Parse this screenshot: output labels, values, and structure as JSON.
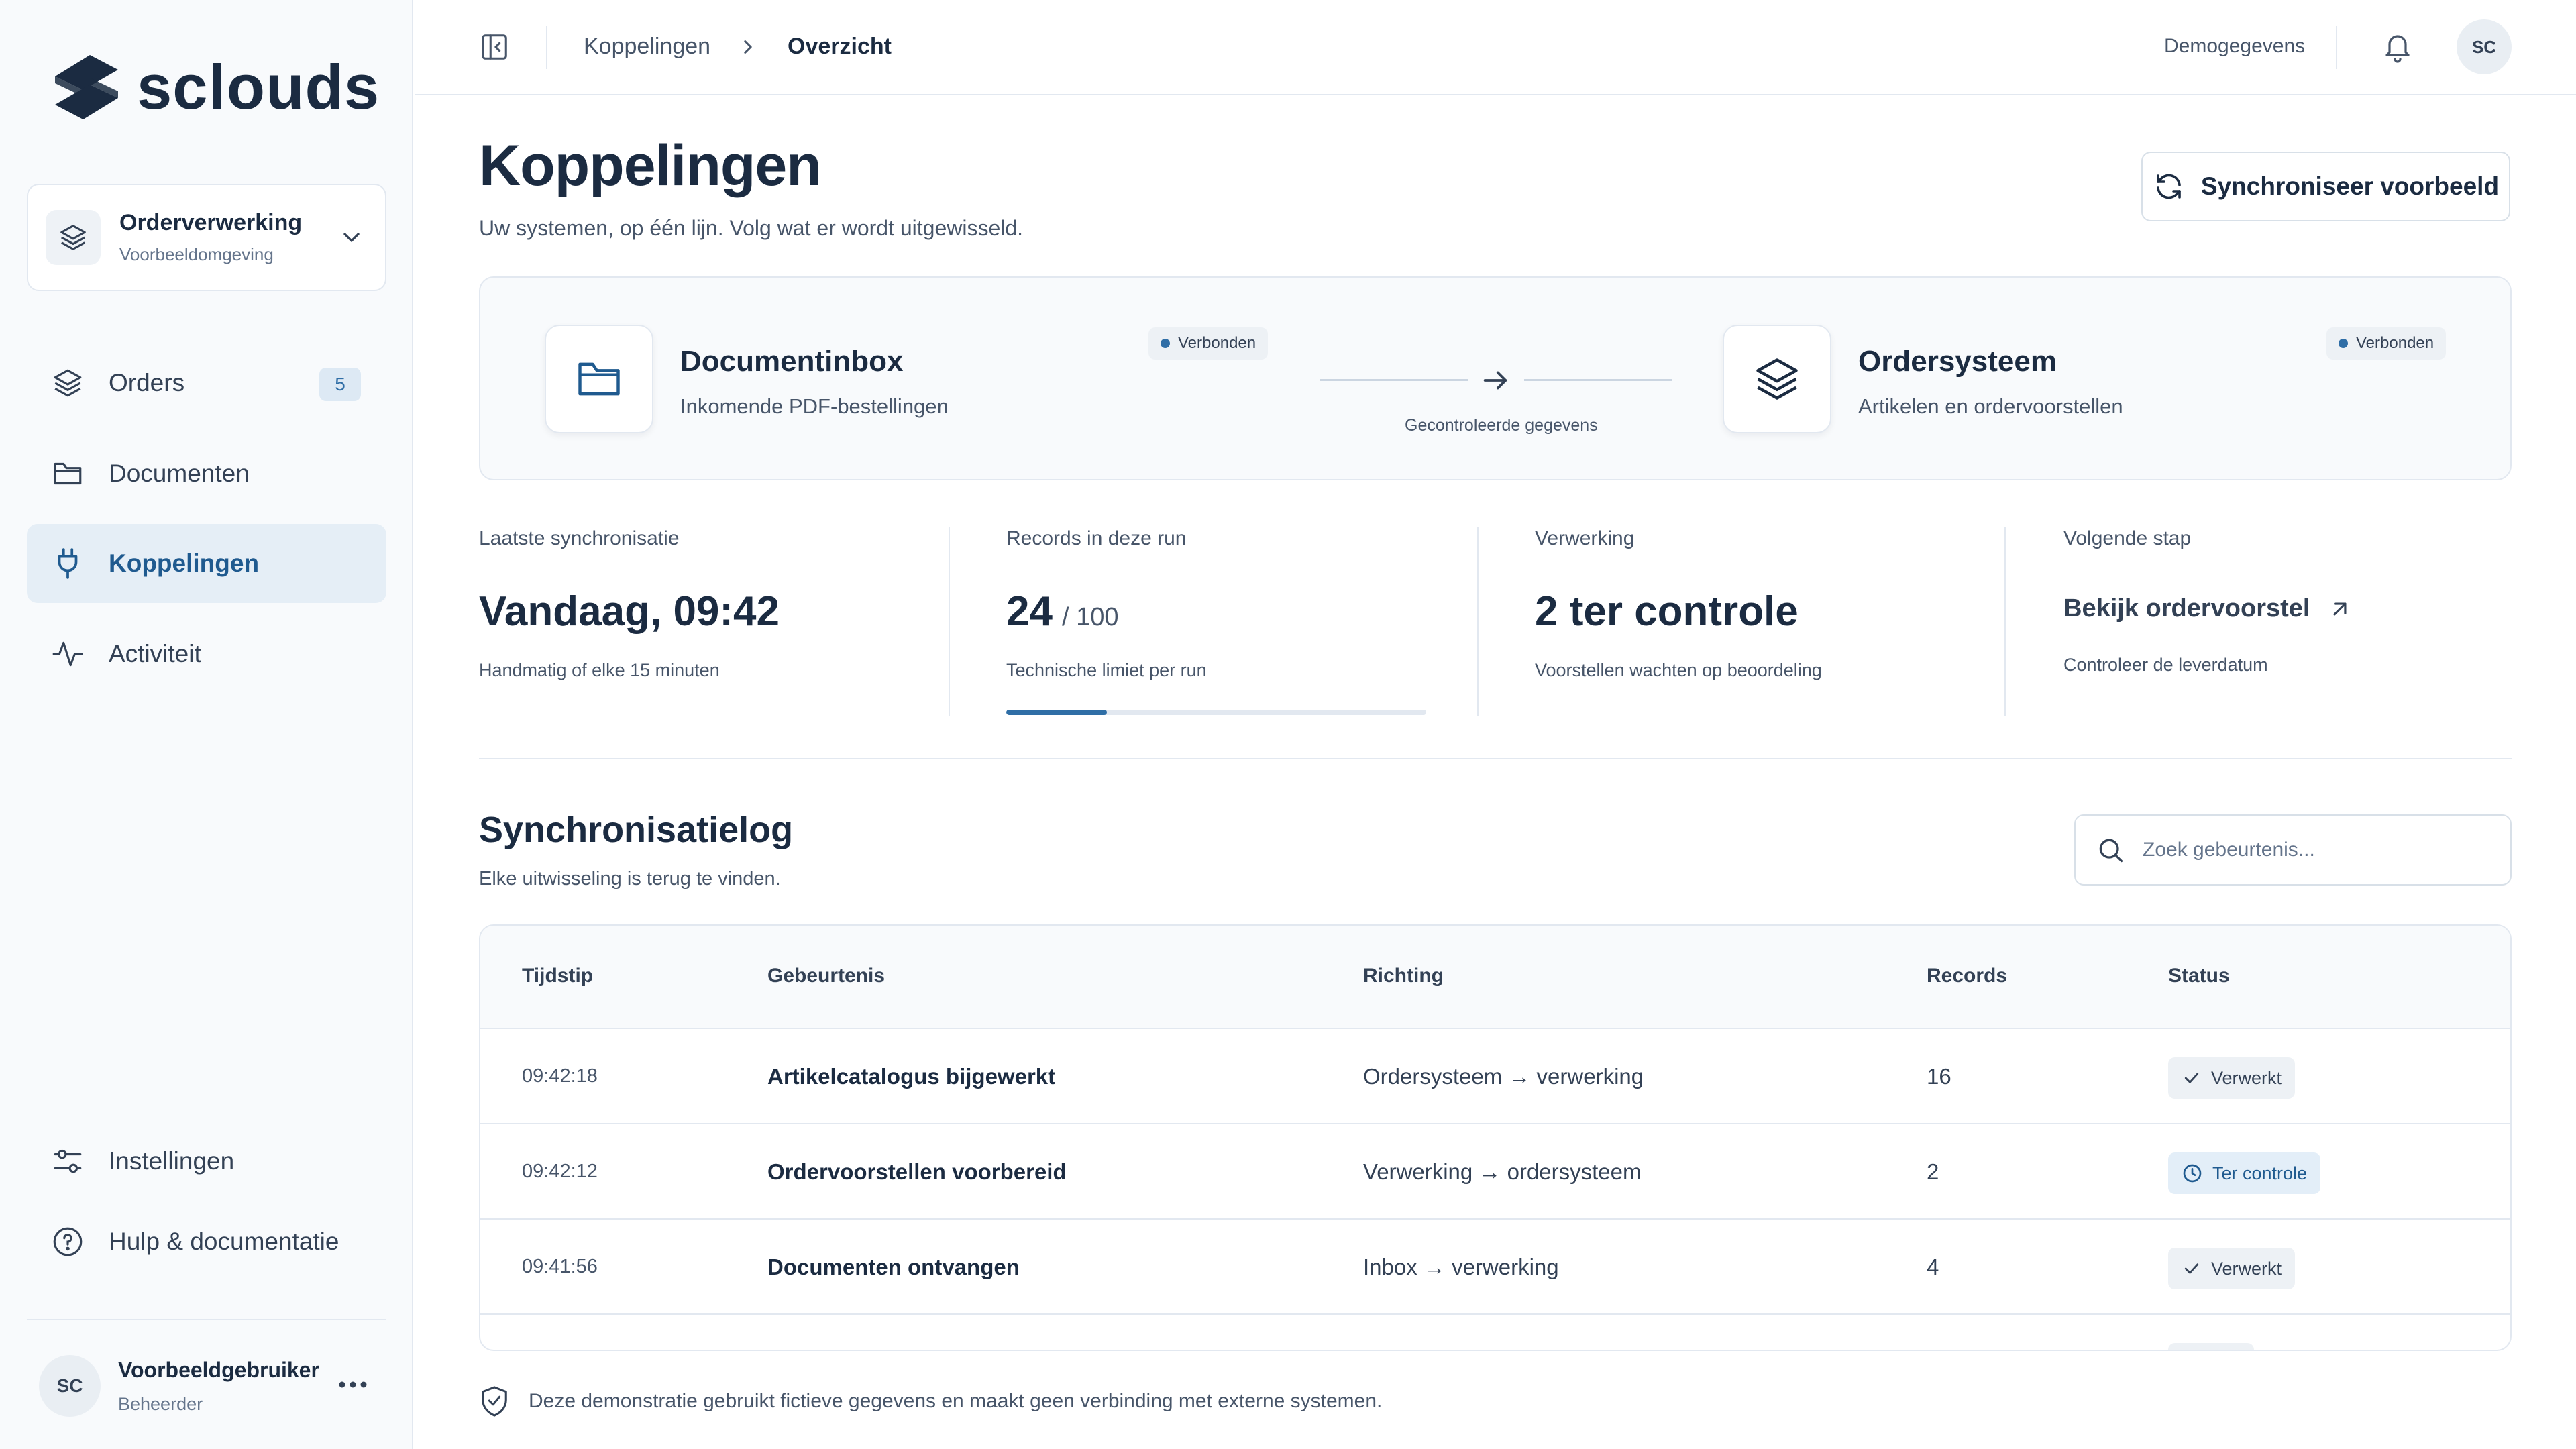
{
  "app": {
    "logo_text": "sclouds"
  },
  "environment": {
    "title": "Orderverwerking",
    "subtitle": "Voorbeeldomgeving"
  },
  "sidebar": {
    "items": [
      {
        "label": "Orders",
        "icon": "layers-icon",
        "badge": "5"
      },
      {
        "label": "Documenten",
        "icon": "folder-icon"
      },
      {
        "label": "Koppelingen",
        "icon": "plug-icon",
        "active": true
      },
      {
        "label": "Activiteit",
        "icon": "activity-icon"
      }
    ],
    "bottom_items": [
      {
        "label": "Instellingen",
        "icon": "sliders-icon"
      },
      {
        "label": "Hulp & documentatie",
        "icon": "help-icon"
      }
    ]
  },
  "user": {
    "initials": "SC",
    "name": "Voorbeeldgebruiker",
    "role": "Beheerder"
  },
  "topbar": {
    "breadcrumb": [
      "Koppelingen",
      "Overzicht"
    ],
    "demo_link": "Demogegevens",
    "avatar": "SC"
  },
  "page": {
    "title": "Koppelingen",
    "subtitle": "Uw systemen, op één lijn. Volg wat er wordt uitgewisseld.",
    "sync_button": "Synchroniseer voorbeeld"
  },
  "flow": {
    "source": {
      "title": "Documentinbox",
      "subtitle": "Inkomende PDF-bestellingen",
      "status": "Verbonden"
    },
    "connector_label": "Gecontroleerde gegevens",
    "target": {
      "title": "Ordersysteem",
      "subtitle": "Artikelen en ordervoorstellen",
      "status": "Verbonden"
    }
  },
  "stats": {
    "last_sync": {
      "label": "Laatste synchronisatie",
      "value": "Vandaag, 09:42",
      "note": "Handmatig of elke 15 minuten"
    },
    "records": {
      "label": "Records in deze run",
      "value": "24",
      "unit": "/ 100",
      "note": "Technische limiet per run",
      "progress": 0.24
    },
    "processing": {
      "label": "Verwerking",
      "value": "2 ter controle",
      "note": "Voorstellen wachten op beoordeling"
    },
    "next_step": {
      "label": "Volgende stap",
      "link": "Bekijk ordervoorstel",
      "note": "Controleer de leverdatum"
    }
  },
  "log": {
    "title": "Synchronisatielog",
    "subtitle": "Elke uitwisseling is terug te vinden.",
    "search_placeholder": "Zoek gebeurtenis...",
    "columns": [
      "Tijdstip",
      "Gebeurtenis",
      "Richting",
      "Records",
      "Status"
    ],
    "rows": [
      {
        "time": "09:42:18",
        "event": "Artikelcatalogus bijgewerkt",
        "direction": "Ordersysteem → verwerking",
        "records": "16",
        "status": "Verwerkt",
        "status_type": "done"
      },
      {
        "time": "09:42:12",
        "event": "Ordervoorstellen voorbereid",
        "direction": "Verwerking → ordersysteem",
        "records": "2",
        "status": "Ter controle",
        "status_type": "review"
      },
      {
        "time": "09:41:56",
        "event": "Documenten ontvangen",
        "direction": "Inbox → verwerking",
        "records": "4",
        "status": "Verwerkt",
        "status_type": "done"
      }
    ]
  },
  "footer": {
    "note": "Deze demonstratie gebruikt fictieve gegevens en maakt geen verbinding met externe systemen."
  },
  "colors": {
    "accent": "#2f6ea6",
    "text": "#1b2b41",
    "sidebar_bg": "#f8fafc",
    "active_bg": "#e5eef6"
  }
}
